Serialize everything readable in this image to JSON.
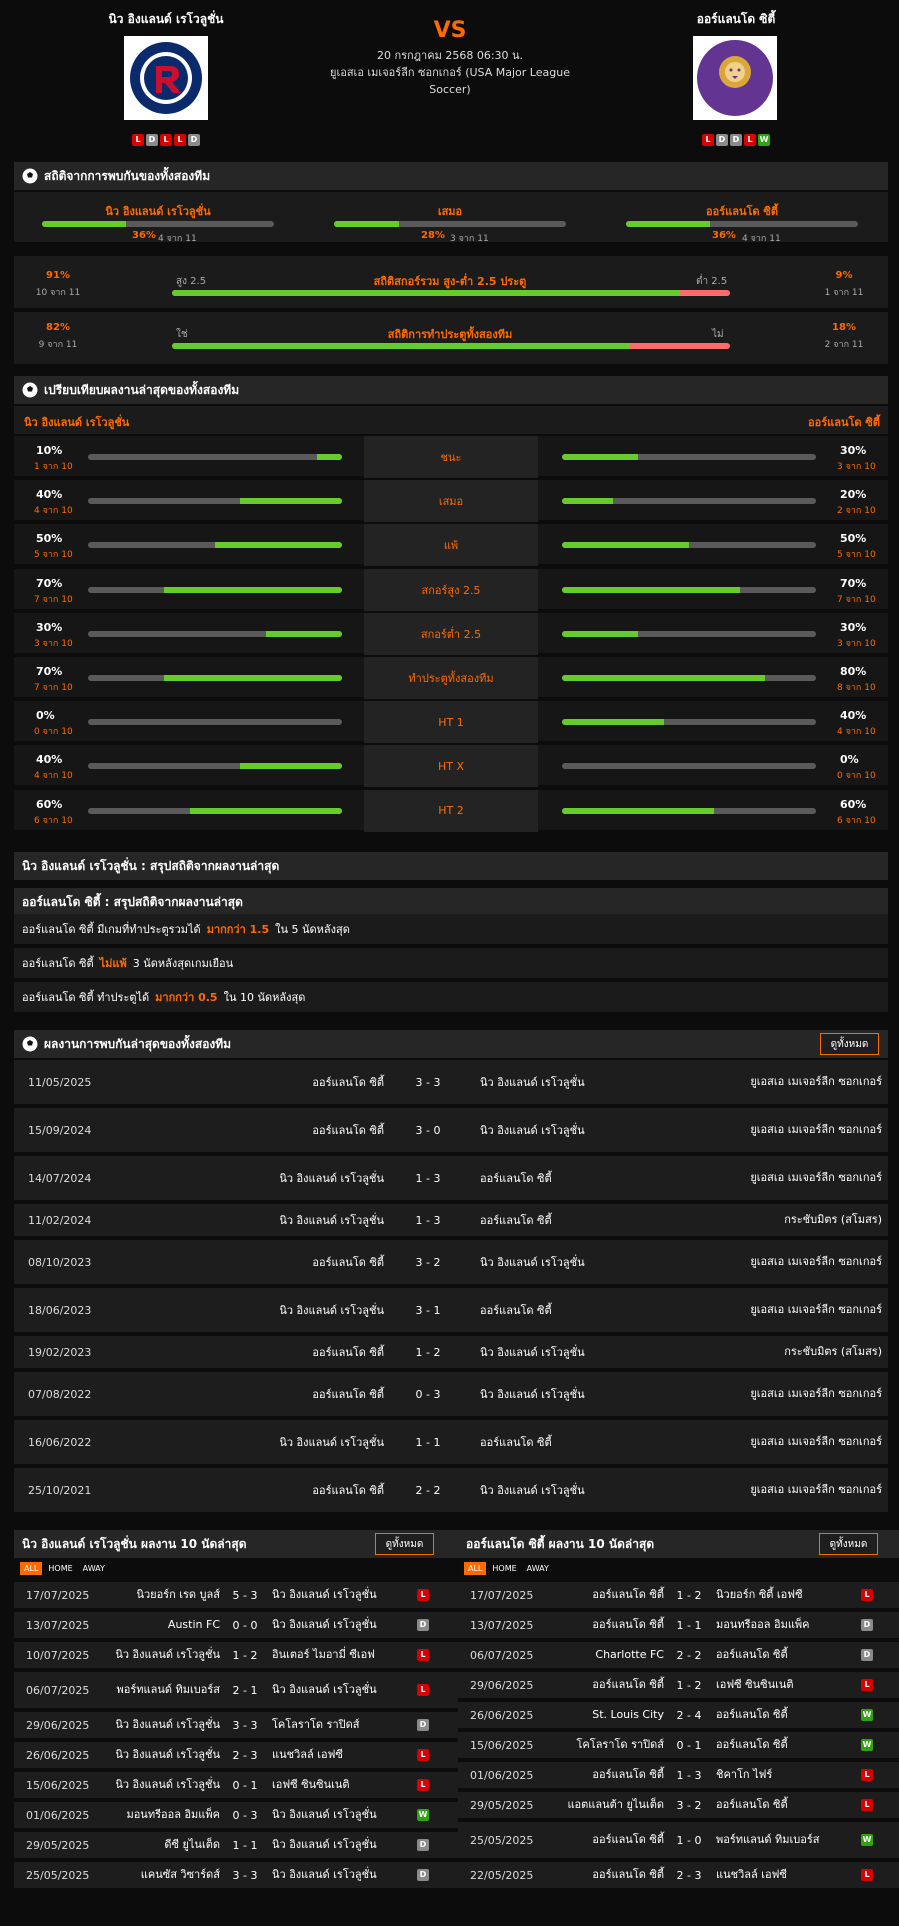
{
  "header": {
    "home_name": "นิว อิงแลนด์ เรโวลูชั่น",
    "away_name": "ออร์แลนโด ซิตี้",
    "vs": "VS",
    "datetime": "20 กรกฎาคม 2568 06:30 น.",
    "league": "ยูเอสเอ เมเจอร์ลีก ซอกเกอร์ (USA Major League Soccer)",
    "home_logo_text": "NEW ENGLAND REVOLUTION",
    "away_logo_text": "ORLANDO CITY",
    "home_form": [
      "L",
      "D",
      "L",
      "L",
      "D"
    ],
    "away_form": [
      "L",
      "D",
      "D",
      "L",
      "W"
    ]
  },
  "h2h_stats": {
    "title": "สถิติจากการพบกันของทั้งสองทีม",
    "home": {
      "label": "นิว อิงแลนด์ เรโวลูชั่น",
      "pct": "36%",
      "sub": "4 จาก 11",
      "value": 0.36
    },
    "draw": {
      "label": "เสมอ",
      "pct": "28%",
      "sub": "3 จาก 11",
      "value": 0.28
    },
    "away": {
      "label": "ออร์แลนโด ซิตี้",
      "pct": "36%",
      "sub": "4 จาก 11",
      "value": 0.36
    },
    "ou": {
      "left_pct": "91%",
      "left_sub": "10 จาก 11",
      "over": "สูง 2.5",
      "title": "สถิติสกอร์รวม สูง-ต่ำ 2.5 ประตู",
      "under": "ต่ำ 2.5",
      "right_pct": "9%",
      "right_sub": "1 จาก 11",
      "value": 0.91
    },
    "btts": {
      "left_pct": "82%",
      "left_sub": "9 จาก 11",
      "yes": "ใช่",
      "title": "สถิติการทำประตูทั้งสองทีม",
      "no": "ไม่",
      "right_pct": "18%",
      "right_sub": "2 จาก 11",
      "value": 0.82
    }
  },
  "compare": {
    "title": "เปรียบเทียบผลงานล่าสุดของทั้งสองทีม",
    "home_name": "นิว อิงแลนด์ เรโวลูชั่น",
    "away_name": "ออร์แลนโด ซิตี้",
    "rows": [
      {
        "label": "ชนะ",
        "hp": "10%",
        "hs": "1 จาก 10",
        "hv": 0.1,
        "ap": "30%",
        "as": "3 จาก 10",
        "av": 0.3
      },
      {
        "label": "เสมอ",
        "hp": "40%",
        "hs": "4 จาก 10",
        "hv": 0.4,
        "ap": "20%",
        "as": "2 จาก 10",
        "av": 0.2
      },
      {
        "label": "แพ้",
        "hp": "50%",
        "hs": "5 จาก 10",
        "hv": 0.5,
        "ap": "50%",
        "as": "5 จาก 10",
        "av": 0.5
      },
      {
        "label": "สกอร์สูง 2.5",
        "hp": "70%",
        "hs": "7 จาก 10",
        "hv": 0.7,
        "ap": "70%",
        "as": "7 จาก 10",
        "av": 0.7
      },
      {
        "label": "สกอร์ต่ำ 2.5",
        "hp": "30%",
        "hs": "3 จาก 10",
        "hv": 0.3,
        "ap": "30%",
        "as": "3 จาก 10",
        "av": 0.3
      },
      {
        "label": "ทำประตูทั้งสองทีม",
        "hp": "70%",
        "hs": "7 จาก 10",
        "hv": 0.7,
        "ap": "80%",
        "as": "8 จาก 10",
        "av": 0.8
      },
      {
        "label": "HT 1",
        "hp": "0%",
        "hs": "0 จาก 10",
        "hv": 0,
        "ap": "40%",
        "as": "4 จาก 10",
        "av": 0.4
      },
      {
        "label": "HT X",
        "hp": "40%",
        "hs": "4 จาก 10",
        "hv": 0.4,
        "ap": "0%",
        "as": "0 จาก 10",
        "av": 0
      },
      {
        "label": "HT 2",
        "hp": "60%",
        "hs": "6 จาก 10",
        "hv": 0.6,
        "ap": "60%",
        "as": "6 จาก 10",
        "av": 0.6
      }
    ]
  },
  "summary": {
    "home_title": "นิว อิงแลนด์ เรโวลูชั่น : สรุปสถิติจากผลงานล่าสุด",
    "away_title": "ออร์แลนโด ซิตี้ : สรุปสถิติจากผลงานล่าสุด",
    "lines": [
      {
        "a": "ออร์แลนโด ซิตี้  มีเกมที่ทำประตูรวมได้",
        "b": "มากกว่า  1.5",
        "c": "ใน 5 นัดหลังสุด"
      },
      {
        "a": "ออร์แลนโด ซิตี้",
        "b": "ไม่แพ้",
        "c": "3  นัดหลังสุดเกมเยือน"
      },
      {
        "a": "ออร์แลนโด ซิตี้  ทำประตูได้",
        "b": "มากกว่า  0.5",
        "c": "ใน 10 นัดหลังสุด"
      }
    ]
  },
  "h2h": {
    "title": "ผลงานการพบกันล่าสุดของทั้งสองทีม",
    "view_all": "ดูทั้งหมด",
    "rows": [
      {
        "date": "11/05/2025",
        "home": "ออร์แลนโด ซิตี้",
        "score": "3 - 3",
        "away": "นิว อิงแลนด์ เรโวลูชั่น",
        "comp": "ยูเอสเอ เมเจอร์ลีก ซอกเกอร์"
      },
      {
        "date": "15/09/2024",
        "home": "ออร์แลนโด ซิตี้",
        "score": "3 - 0",
        "away": "นิว อิงแลนด์ เรโวลูชั่น",
        "comp": "ยูเอสเอ เมเจอร์ลีก ซอกเกอร์"
      },
      {
        "date": "14/07/2024",
        "home": "นิว อิงแลนด์ เรโวลูชั่น",
        "score": "1 - 3",
        "away": "ออร์แลนโด ซิตี้",
        "comp": "ยูเอสเอ เมเจอร์ลีก ซอกเกอร์"
      },
      {
        "date": "11/02/2024",
        "home": "นิว อิงแลนด์ เรโวลูชั่น",
        "score": "1 - 3",
        "away": "ออร์แลนโด ซิตี้",
        "comp": "กระชับมิตร (สโมสร)"
      },
      {
        "date": "08/10/2023",
        "home": "ออร์แลนโด ซิตี้",
        "score": "3 - 2",
        "away": "นิว อิงแลนด์ เรโวลูชั่น",
        "comp": "ยูเอสเอ เมเจอร์ลีก ซอกเกอร์"
      },
      {
        "date": "18/06/2023",
        "home": "นิว อิงแลนด์ เรโวลูชั่น",
        "score": "3 - 1",
        "away": "ออร์แลนโด ซิตี้",
        "comp": "ยูเอสเอ เมเจอร์ลีก ซอกเกอร์"
      },
      {
        "date": "19/02/2023",
        "home": "ออร์แลนโด ซิตี้",
        "score": "1 - 2",
        "away": "นิว อิงแลนด์ เรโวลูชั่น",
        "comp": "กระชับมิตร (สโมสร)"
      },
      {
        "date": "07/08/2022",
        "home": "ออร์แลนโด ซิตี้",
        "score": "0 - 3",
        "away": "นิว อิงแลนด์ เรโวลูชั่น",
        "comp": "ยูเอสเอ เมเจอร์ลีก ซอกเกอร์"
      },
      {
        "date": "16/06/2022",
        "home": "นิว อิงแลนด์ เรโวลูชั่น",
        "score": "1 - 1",
        "away": "ออร์แลนโด ซิตี้",
        "comp": "ยูเอสเอ เมเจอร์ลีก ซอกเกอร์"
      },
      {
        "date": "25/10/2021",
        "home": "ออร์แลนโด ซิตี้",
        "score": "2 - 2",
        "away": "นิว อิงแลนด์ เรโวลูชั่น",
        "comp": "ยูเอสเอ เมเจอร์ลีก ซอกเกอร์"
      }
    ]
  },
  "last10": {
    "tabs": [
      "ALL",
      "HOME",
      "AWAY"
    ],
    "view_all": "ดูทั้งหมด",
    "home": {
      "title": "นิว อิงแลนด์ เรโวลูชั่น ผลงาน 10 นัดล่าสุด",
      "rows": [
        {
          "date": "17/07/2025",
          "home": "นิวยอร์ก เรด บูลส์",
          "score": "5 - 3",
          "away": "นิว อิงแลนด์ เรโวลูชั่น",
          "r": "L"
        },
        {
          "date": "13/07/2025",
          "home": "Austin FC",
          "score": "0 - 0",
          "away": "นิว อิงแลนด์ เรโวลูชั่น",
          "r": "D"
        },
        {
          "date": "10/07/2025",
          "home": "นิว อิงแลนด์ เรโวลูชั่น",
          "score": "1 - 2",
          "away": "อินเตอร์ ไมอามี่ ซีเอฟ",
          "r": "L"
        },
        {
          "date": "06/07/2025",
          "home": "พอร์ทแลนด์ ทิมเบอร์ส",
          "score": "2 - 1",
          "away": "นิว อิงแลนด์ เรโวลูชั่น",
          "r": "L"
        },
        {
          "date": "29/06/2025",
          "home": "นิว อิงแลนด์ เรโวลูชั่น",
          "score": "3 - 3",
          "away": "โคโลราโด ราปิดส์",
          "r": "D"
        },
        {
          "date": "26/06/2025",
          "home": "นิว อิงแลนด์ เรโวลูชั่น",
          "score": "2 - 3",
          "away": "แนชวิลล์ เอฟซี",
          "r": "L"
        },
        {
          "date": "15/06/2025",
          "home": "นิว อิงแลนด์ เรโวลูชั่น",
          "score": "0 - 1",
          "away": "เอฟซี ซินซินเนติ",
          "r": "L"
        },
        {
          "date": "01/06/2025",
          "home": "มอนทรีออล อิมแพ็ค",
          "score": "0 - 3",
          "away": "นิว อิงแลนด์ เรโวลูชั่น",
          "r": "W"
        },
        {
          "date": "29/05/2025",
          "home": "ดีซี ยูไนเต็ด",
          "score": "1 - 1",
          "away": "นิว อิงแลนด์ เรโวลูชั่น",
          "r": "D"
        },
        {
          "date": "25/05/2025",
          "home": "แคนซัส วิซาร์ดส์",
          "score": "3 - 3",
          "away": "นิว อิงแลนด์ เรโวลูชั่น",
          "r": "D"
        }
      ]
    },
    "away": {
      "title": "ออร์แลนโด ซิตี้ ผลงาน 10 นัดล่าสุด",
      "rows": [
        {
          "date": "17/07/2025",
          "home": "ออร์แลนโด ซิตี้",
          "score": "1 - 2",
          "away": "นิวยอร์ก ซิตี้ เอฟซี",
          "r": "L"
        },
        {
          "date": "13/07/2025",
          "home": "ออร์แลนโด ซิตี้",
          "score": "1 - 1",
          "away": "มอนทรีออล อิมแพ็ค",
          "r": "D"
        },
        {
          "date": "06/07/2025",
          "home": "Charlotte FC",
          "score": "2 - 2",
          "away": "ออร์แลนโด ซิตี้",
          "r": "D"
        },
        {
          "date": "29/06/2025",
          "home": "ออร์แลนโด ซิตี้",
          "score": "1 - 2",
          "away": "เอฟซี ซินซินเนติ",
          "r": "L"
        },
        {
          "date": "26/06/2025",
          "home": "St. Louis City",
          "score": "2 - 4",
          "away": "ออร์แลนโด ซิตี้",
          "r": "W"
        },
        {
          "date": "15/06/2025",
          "home": "โคโลราโด ราปิดส์",
          "score": "0 - 1",
          "away": "ออร์แลนโด ซิตี้",
          "r": "W"
        },
        {
          "date": "01/06/2025",
          "home": "ออร์แลนโด ซิตี้",
          "score": "1 - 3",
          "away": "ชิคาโก ไฟร์",
          "r": "L"
        },
        {
          "date": "29/05/2025",
          "home": "แอตแลนต้า ยูไนเต็ด",
          "score": "3 - 2",
          "away": "ออร์แลนโด ซิตี้",
          "r": "L"
        },
        {
          "date": "25/05/2025",
          "home": "ออร์แลนโด ซิตี้",
          "score": "1 - 0",
          "away": "พอร์ทแลนด์ ทิมเบอร์ส",
          "r": "W"
        },
        {
          "date": "22/05/2025",
          "home": "ออร์แลนโด ซิตี้",
          "score": "2 - 3",
          "away": "แนชวิลล์ เอฟซี",
          "r": "L"
        }
      ]
    }
  },
  "colors": {
    "accent": "#ff6a00",
    "green": "#66cc2a",
    "red": "#ff6b6b",
    "panel": "#262626",
    "win": "#2fa40f",
    "loss": "#d80000",
    "draw": "#8a8a8a"
  }
}
